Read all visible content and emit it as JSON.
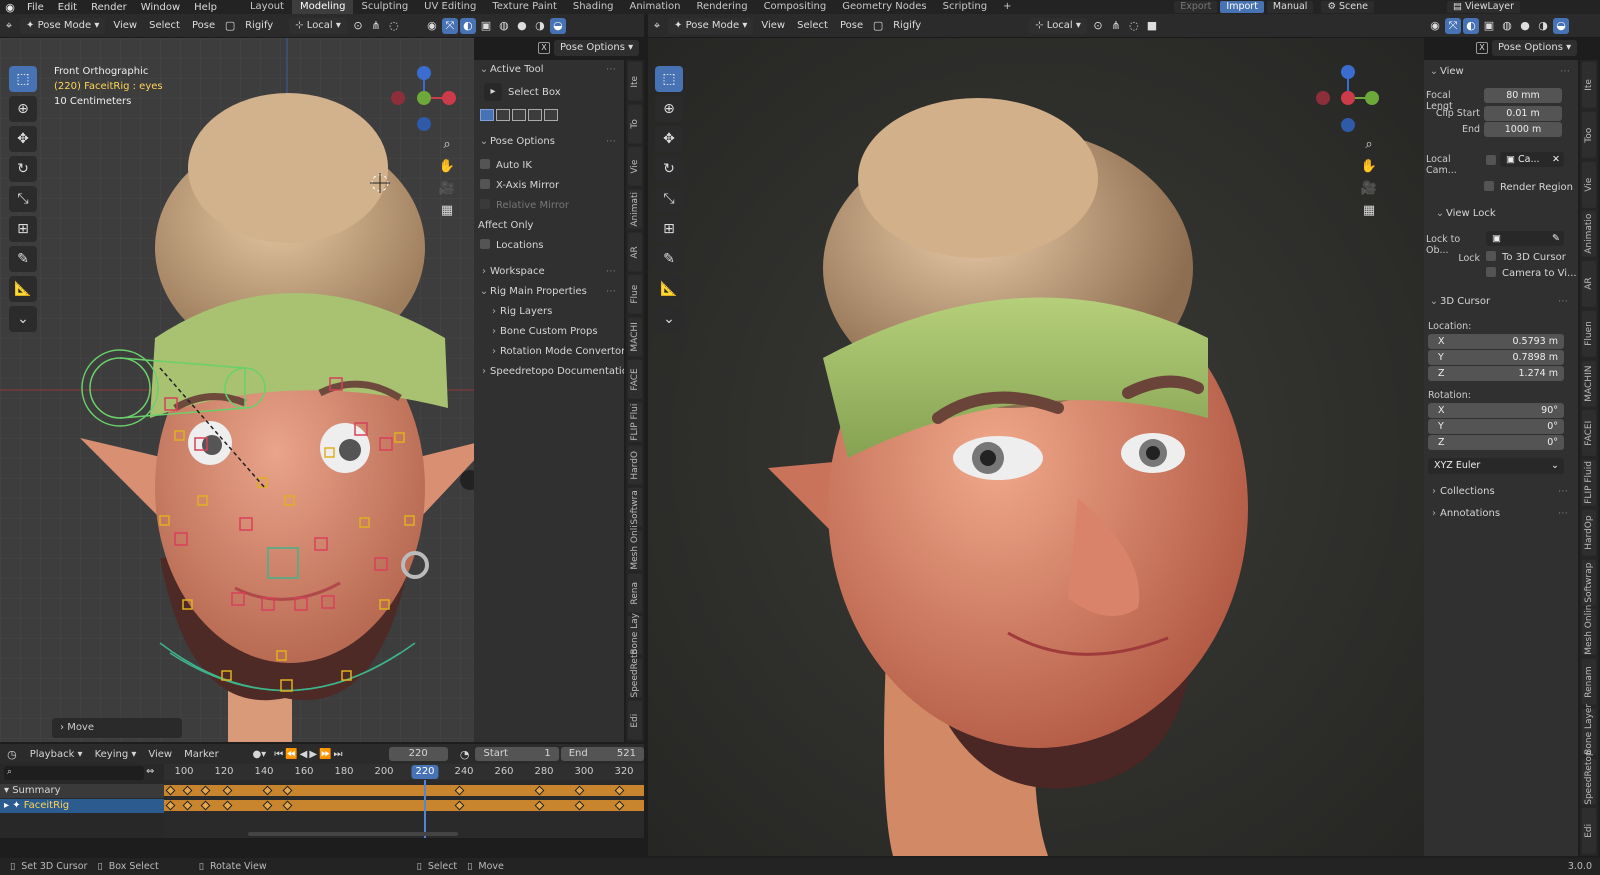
{
  "topbar": {
    "menus": [
      "File",
      "Edit",
      "Render",
      "Window",
      "Help"
    ],
    "workspaces": [
      {
        "label": "Layout",
        "active": false
      },
      {
        "label": "Modeling",
        "active": true
      },
      {
        "label": "Sculpting",
        "active": false
      },
      {
        "label": "UV Editing",
        "active": false
      },
      {
        "label": "Texture Paint",
        "active": false
      },
      {
        "label": "Shading",
        "active": false
      },
      {
        "label": "Animation",
        "active": false
      },
      {
        "label": "Rendering",
        "active": false
      },
      {
        "label": "Compositing",
        "active": false
      },
      {
        "label": "Geometry Nodes",
        "active": false
      },
      {
        "label": "Scripting",
        "active": false
      }
    ],
    "add_tab": "+",
    "export_label": "Export",
    "import_label": "Import",
    "manual_label": "Manual",
    "scene_label": "Scene",
    "viewlayer_label": "ViewLayer"
  },
  "left_viewport": {
    "header": {
      "mode": "Pose Mode",
      "menus": [
        "View",
        "Select",
        "Pose"
      ],
      "rigify": "Rigify",
      "orientation": "Local"
    },
    "pose_options_label": "Pose Options",
    "close_label": "X",
    "overlay": {
      "view_name": "Front Orthographic",
      "object_info": "(220) FaceitRig : eyes",
      "scale": "10 Centimeters"
    },
    "last_op": "Move",
    "npanel": {
      "active_tool": "Active Tool",
      "select_box": "Select Box",
      "pose_options": "Pose Options",
      "auto_ik": "Auto IK",
      "x_axis_mirror": "X-Axis Mirror",
      "relative_mirror": "Relative Mirror",
      "affect_only": "Affect Only",
      "locations": "Locations",
      "workspace": "Workspace",
      "rig_main_properties": "Rig Main Properties",
      "rig_layers": "Rig Layers",
      "bone_custom_props": "Bone Custom Props",
      "rotation_mode_convertor": "Rotation Mode Convertor",
      "speedretopo_docs": "Speedretopo Documentation"
    },
    "side_tabs": [
      "Ite",
      "To",
      "Vie",
      "Animati",
      "AR",
      "Flue",
      "MACHI",
      "FACE",
      "FLIP Flui",
      "HardO",
      "Softwra",
      "Mesh Onli",
      "Rena",
      "Bone Lay",
      "SpeedReto",
      "Edi"
    ]
  },
  "timeline": {
    "playback": "Playback",
    "keying": "Keying",
    "view": "View",
    "marker": "Marker",
    "current_frame": "220",
    "start_label": "Start",
    "start_value": "1",
    "end_label": "End",
    "end_value": "521",
    "ruler": [
      "100",
      "120",
      "140",
      "160",
      "180",
      "200",
      "220",
      "240",
      "260",
      "280",
      "300",
      "320"
    ],
    "tracks": [
      "Summary",
      "FaceitRig"
    ]
  },
  "right_viewport": {
    "header": {
      "mode": "Pose Mode",
      "menus": [
        "View",
        "Select",
        "Pose"
      ],
      "rigify": "Rigify",
      "orientation": "Local"
    },
    "pose_options_label": "Pose Options",
    "close_label": "X",
    "npanel": {
      "view": "View",
      "focal_label": "Focal Lengt",
      "focal_value": "80 mm",
      "clip_start_label": "Clip Start",
      "clip_start_value": "0.01 m",
      "clip_end_label": "End",
      "clip_end_value": "1000 m",
      "local_camera_label": "Local Cam...",
      "local_camera_value": "Ca...",
      "render_region": "Render Region",
      "view_lock": "View Lock",
      "lock_to_object": "Lock to Ob...",
      "lock_label": "Lock",
      "to_3d_cursor": "To 3D Cursor",
      "camera_to_view": "Camera to Vi...",
      "cursor_3d": "3D Cursor",
      "location_label": "Location:",
      "loc_x_label": "X",
      "loc_x": "0.5793 m",
      "loc_y_label": "Y",
      "loc_y": "0.7898 m",
      "loc_z_label": "Z",
      "loc_z": "1.274 m",
      "rotation_label": "Rotation:",
      "rot_x_label": "X",
      "rot_x": "90°",
      "rot_y_label": "Y",
      "rot_y": "0°",
      "rot_z_label": "Z",
      "rot_z": "0°",
      "rotation_mode": "XYZ Euler",
      "collections": "Collections",
      "annotations": "Annotations"
    },
    "side_tabs": [
      "Ite",
      "Too",
      "Vie",
      "Animatio",
      "AR",
      "Fluen",
      "MACHIN",
      "FACEI",
      "FLIP Fluid",
      "HardOp",
      "Softwrap",
      "Mesh Onlin",
      "Renam",
      "Bone Layer",
      "SpeedRetop",
      "Edi"
    ]
  },
  "statusbar": {
    "set_cursor": "Set 3D Cursor",
    "box_select": "Box Select",
    "rotate_view": "Rotate View",
    "select": "Select",
    "move": "Move",
    "version": "3.0.0"
  },
  "colors": {
    "accent": "#4772b3",
    "keyframe": "#e6a84a",
    "track_bar": "#c9852d",
    "bone_red": "#d8405a",
    "bone_yellow": "#e0b020",
    "bone_green": "#6ad06a"
  }
}
